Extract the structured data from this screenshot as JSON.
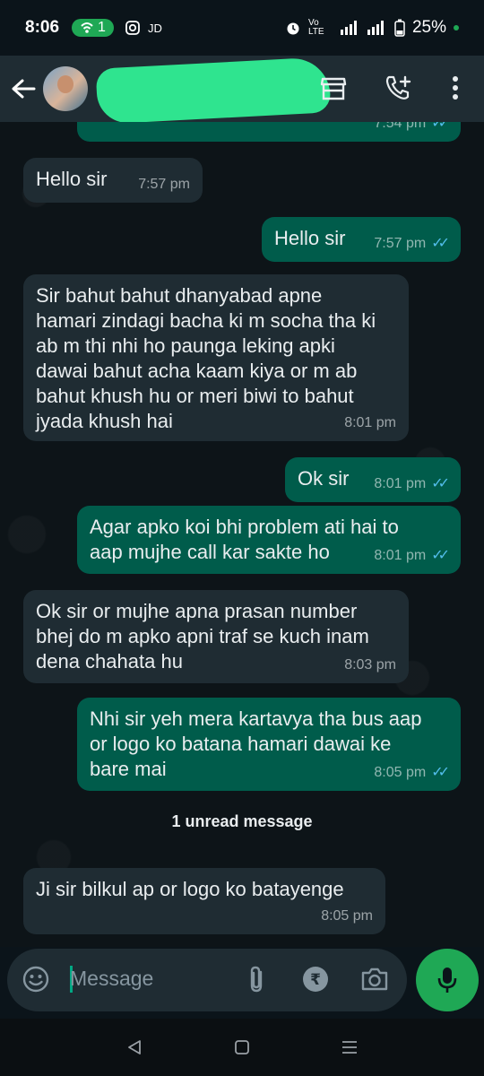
{
  "status_bar": {
    "time": "8:06",
    "hotspot_count": "1",
    "carrier_tag": "JD",
    "network_tag": "Vo LTE",
    "battery": "25%"
  },
  "header": {
    "back_icon": "arrow-left-icon",
    "menu_icon": "more-vert-icon"
  },
  "messages": [
    {
      "id": "m0",
      "direction": "out",
      "text": "",
      "time": "7:54 pm",
      "read": true
    },
    {
      "id": "m1",
      "direction": "in",
      "text": "Hello sir",
      "time": "7:57 pm"
    },
    {
      "id": "m2",
      "direction": "out",
      "text": "Hello sir",
      "time": "7:57 pm",
      "read": true
    },
    {
      "id": "m3",
      "direction": "in",
      "text": "Sir bahut bahut dhanyabad apne hamari zindagi bacha ki m socha tha ki ab m thi nhi ho paunga leking apki dawai bahut acha kaam kiya or m ab bahut khush hu or meri biwi to bahut jyada khush hai",
      "time": "8:01 pm"
    },
    {
      "id": "m4",
      "direction": "out",
      "text": "Ok sir",
      "time": "8:01 pm",
      "read": true
    },
    {
      "id": "m5",
      "direction": "out",
      "text": "Agar apko koi bhi problem ati hai to aap mujhe call kar sakte ho",
      "time": "8:01 pm",
      "read": true
    },
    {
      "id": "m6",
      "direction": "in",
      "text": "Ok sir or mujhe apna prasan number bhej do m apko apni traf se kuch inam dena chahata hu",
      "time": "8:03 pm"
    },
    {
      "id": "m7",
      "direction": "out",
      "text": "Nhi sir yeh mera kartavya tha bus aap or logo ko batana hamari dawai ke bare mai",
      "time": "8:05 pm",
      "read": true
    },
    {
      "id": "m8",
      "direction": "in",
      "text": "Ji sir bilkul ap or logo ko batayenge",
      "time": "8:05 pm"
    }
  ],
  "unread_divider": "1 unread message",
  "composer": {
    "placeholder": "Message"
  },
  "colors": {
    "incoming_bubble": "#1f2c33",
    "outgoing_bubble": "#005c4b",
    "accent_green": "#1fa855",
    "read_ticks": "#53bdeb"
  }
}
